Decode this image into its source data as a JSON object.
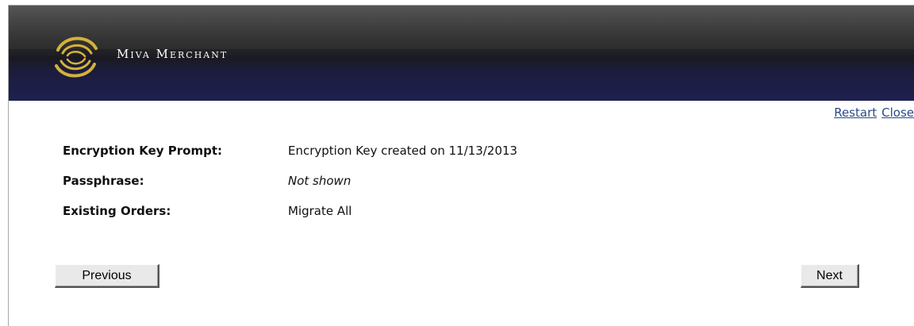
{
  "brand": {
    "name": "Miva Merchant",
    "logo_icon": "swirl-logo-icon"
  },
  "nav": {
    "restart_label": "Restart",
    "close_label": "Close"
  },
  "summary": {
    "rows": [
      {
        "label": "Encryption Key Prompt:",
        "value": "Encryption Key created on 11/13/2013"
      },
      {
        "label": "Passphrase:",
        "value": "Not shown"
      },
      {
        "label": "Existing Orders:",
        "value": "Migrate All"
      }
    ]
  },
  "buttons": {
    "previous_label": "Previous",
    "next_label": "Next"
  },
  "colors": {
    "header_dark": "#2c2c2c",
    "header_navy": "#1e2050",
    "link": "#2a4a8a",
    "logo_gold": "#d4b23a"
  }
}
